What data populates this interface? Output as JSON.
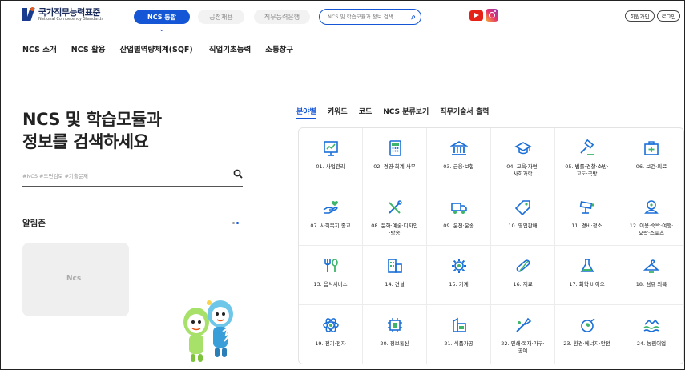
{
  "header": {
    "logo_ko": "국가직무능력표준",
    "logo_en": "National Competency Standards",
    "tabs": [
      "NCS 통합",
      "공정채용",
      "직무능력은행"
    ],
    "search_placeholder": "NCS 및 학습모듈과 정보 검색",
    "join_label": "회원가입",
    "login_label": "로그인"
  },
  "gnb": [
    "NCS 소개",
    "NCS 활용",
    "산업별역량체계(SQF)",
    "직업기초능력",
    "소통창구"
  ],
  "hero": {
    "line1": "NCS 및 학습모듈과",
    "line2": "정보를 검색하세요",
    "search_placeholder": "#NCS #도면검토 #기출문제"
  },
  "notice": {
    "title": "알림존",
    "thumb_label": "Ncs"
  },
  "category_tabs": [
    "분야별",
    "키워드",
    "코드",
    "NCS 분류보기",
    "직무기술서 출력"
  ],
  "categories": [
    {
      "label": "01. 사업관리",
      "icon": "chart-board-icon"
    },
    {
      "label": "02. 경영·회계·사무",
      "icon": "calculator-icon"
    },
    {
      "label": "03. 금융·보험",
      "icon": "bank-icon"
    },
    {
      "label": "04. 교육·자연·\n사회과학",
      "icon": "graduation-cap-icon"
    },
    {
      "label": "05. 법률·경찰·소방·\n교도·국방",
      "icon": "gavel-icon"
    },
    {
      "label": "06. 보건·의료",
      "icon": "first-aid-icon"
    },
    {
      "label": "07. 사회복지·종교",
      "icon": "helping-hand-icon"
    },
    {
      "label": "08. 문화·예술·디자인\n·방송",
      "icon": "design-tools-icon"
    },
    {
      "label": "09. 운전·운송",
      "icon": "truck-icon"
    },
    {
      "label": "10. 영업판매",
      "icon": "price-tag-icon"
    },
    {
      "label": "11. 경비·청소",
      "icon": "cctv-icon"
    },
    {
      "label": "12. 이용·숙박·여행·\n오락·스포츠",
      "icon": "travel-icon"
    },
    {
      "label": "13. 음식서비스",
      "icon": "fork-spoon-icon"
    },
    {
      "label": "14. 건설",
      "icon": "building-icon"
    },
    {
      "label": "15. 기계",
      "icon": "gear-icon"
    },
    {
      "label": "16. 재료",
      "icon": "pipes-icon"
    },
    {
      "label": "17. 화학·바이오",
      "icon": "flask-icon"
    },
    {
      "label": "18. 섬유·의복",
      "icon": "hanger-icon"
    },
    {
      "label": "19. 전기·전자",
      "icon": "atom-icon"
    },
    {
      "label": "20. 정보통신",
      "icon": "chip-icon"
    },
    {
      "label": "21. 식품가공",
      "icon": "food-package-icon"
    },
    {
      "label": "22. 인쇄·목재·가구·\n공예",
      "icon": "brush-icon"
    },
    {
      "label": "23. 환경·에너지·안전",
      "icon": "plug-leaf-icon"
    },
    {
      "label": "24. 농림어업",
      "icon": "farm-waves-icon"
    }
  ],
  "colors": {
    "primary": "#1556d6",
    "icon_blue": "#1a6fd8",
    "icon_green": "#3fb56a"
  }
}
